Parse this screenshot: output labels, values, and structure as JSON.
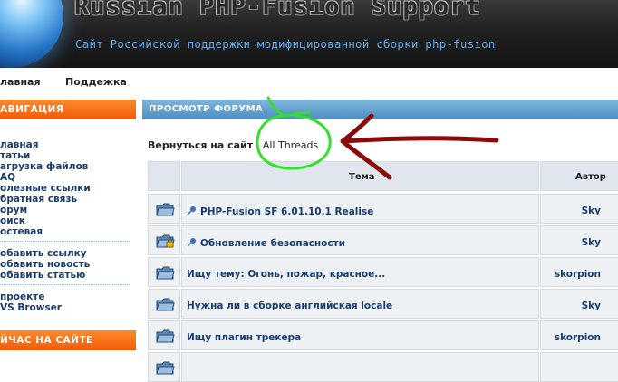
{
  "header": {
    "title": "Russian PHP-Fusion Support",
    "subtitle": "Сайт Российской поддержки модифицированной сборки php-fusion"
  },
  "topnav": {
    "items": [
      {
        "label": "лавная"
      },
      {
        "label": "Поддежка"
      }
    ]
  },
  "sidebar": {
    "nav_header": "АВИГАЦИЯ",
    "nav_items": [
      {
        "label": "лавная"
      },
      {
        "label": "татьи"
      },
      {
        "label": "агрузка файлов"
      },
      {
        "label": "AQ"
      },
      {
        "label": "олезные ссылки"
      },
      {
        "label": "братная связь"
      },
      {
        "label": "орум"
      },
      {
        "label": "оиск"
      },
      {
        "label": "остевая"
      }
    ],
    "add_items": [
      {
        "label": "обавить ссылку"
      },
      {
        "label": "обавить новость"
      },
      {
        "label": "обавить статью"
      }
    ],
    "about_items": [
      {
        "label": " проекте"
      },
      {
        "label": "VS Browser"
      }
    ],
    "online_header": "ЙЧАС НА САЙТЕ"
  },
  "main": {
    "panel_title": "ПРОСМОТР ФОРУМА",
    "back_link": "Вернуться на сайт",
    "separator": "|",
    "all_threads_link": "All Threads",
    "table": {
      "headers": {
        "topic": "Тема",
        "author": "Автор"
      },
      "rows": [
        {
          "topic": "PHP-Fusion SF 6.01.10.1 Realise",
          "author": "Sky",
          "icon": "folder-icon",
          "pinned": true,
          "locked": false
        },
        {
          "topic": "Обновление безопасности",
          "author": "Sky",
          "icon": "locked-folder-icon",
          "pinned": true,
          "locked": true
        },
        {
          "topic": "Ищу тему: Огонь, пожар, красное...",
          "author": "skorpion",
          "icon": "folder-icon",
          "pinned": false,
          "locked": false
        },
        {
          "topic": "Нужна ли в сборке английская locale",
          "author": "Sky",
          "icon": "folder-icon",
          "pinned": false,
          "locked": false
        },
        {
          "topic": "Ищу плагин трекера",
          "author": "skorpion",
          "icon": "folder-icon",
          "pinned": false,
          "locked": false
        }
      ]
    }
  },
  "colors": {
    "orange_header": "#f05a06",
    "blue_header": "#4d8dc0",
    "link": "#1a3c6e",
    "annotation_green": "#33e02a",
    "annotation_red": "#8b0a0a"
  }
}
